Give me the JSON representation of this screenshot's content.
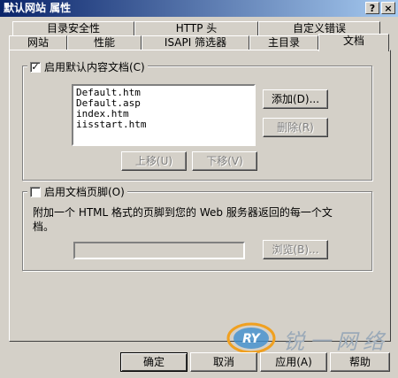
{
  "window": {
    "title": "默认网站 属性",
    "help_btn": "?",
    "close_btn": "×"
  },
  "tabs": {
    "row1": [
      "目录安全性",
      "HTTP 头",
      "自定义错误"
    ],
    "row2": [
      "网站",
      "性能",
      "ISAPI 筛选器",
      "主目录",
      "文档"
    ]
  },
  "default_doc": {
    "checkbox_label": "启用默认内容文档(C)",
    "checked": true,
    "check_mark": "✓",
    "files": [
      "Default.htm",
      "Default.asp",
      "index.htm",
      "iisstart.htm"
    ],
    "add_label": "添加(D)...",
    "remove_label": "删除(R)",
    "move_up_label": "上移(U)",
    "move_down_label": "下移(V)"
  },
  "footer": {
    "checkbox_label": "启用文档页脚(O)",
    "checked": false,
    "description_line1": "附加一个 HTML 格式的页脚到您的 Web 服务器返回的每一个文",
    "description_line2": "档。",
    "path_value": "",
    "browse_label": "浏览(B)..."
  },
  "buttons": {
    "ok": "确定",
    "cancel": "取消",
    "apply": "应用(A)",
    "help": "帮助"
  },
  "watermark": {
    "logo": "RY",
    "text": "锐一网络"
  }
}
